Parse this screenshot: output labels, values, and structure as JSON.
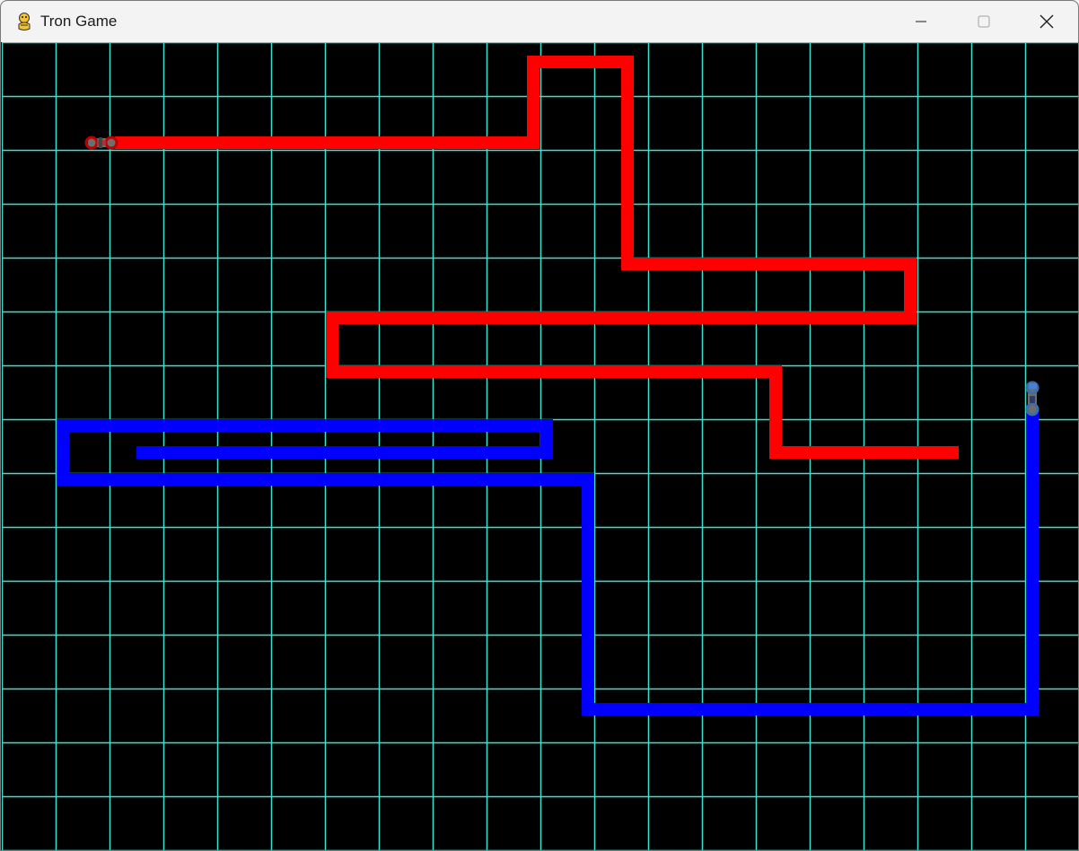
{
  "window": {
    "title": "Tron Game",
    "app_icon": "python-snake-icon",
    "controls": [
      "minimize-icon",
      "maximize-icon",
      "close-icon"
    ]
  },
  "game": {
    "background_color": "#000000",
    "grid_color": "#40e0d0",
    "players": [
      {
        "name": "red",
        "color": "#ff0000"
      },
      {
        "name": "blue",
        "color": "#0000ff"
      }
    ]
  }
}
